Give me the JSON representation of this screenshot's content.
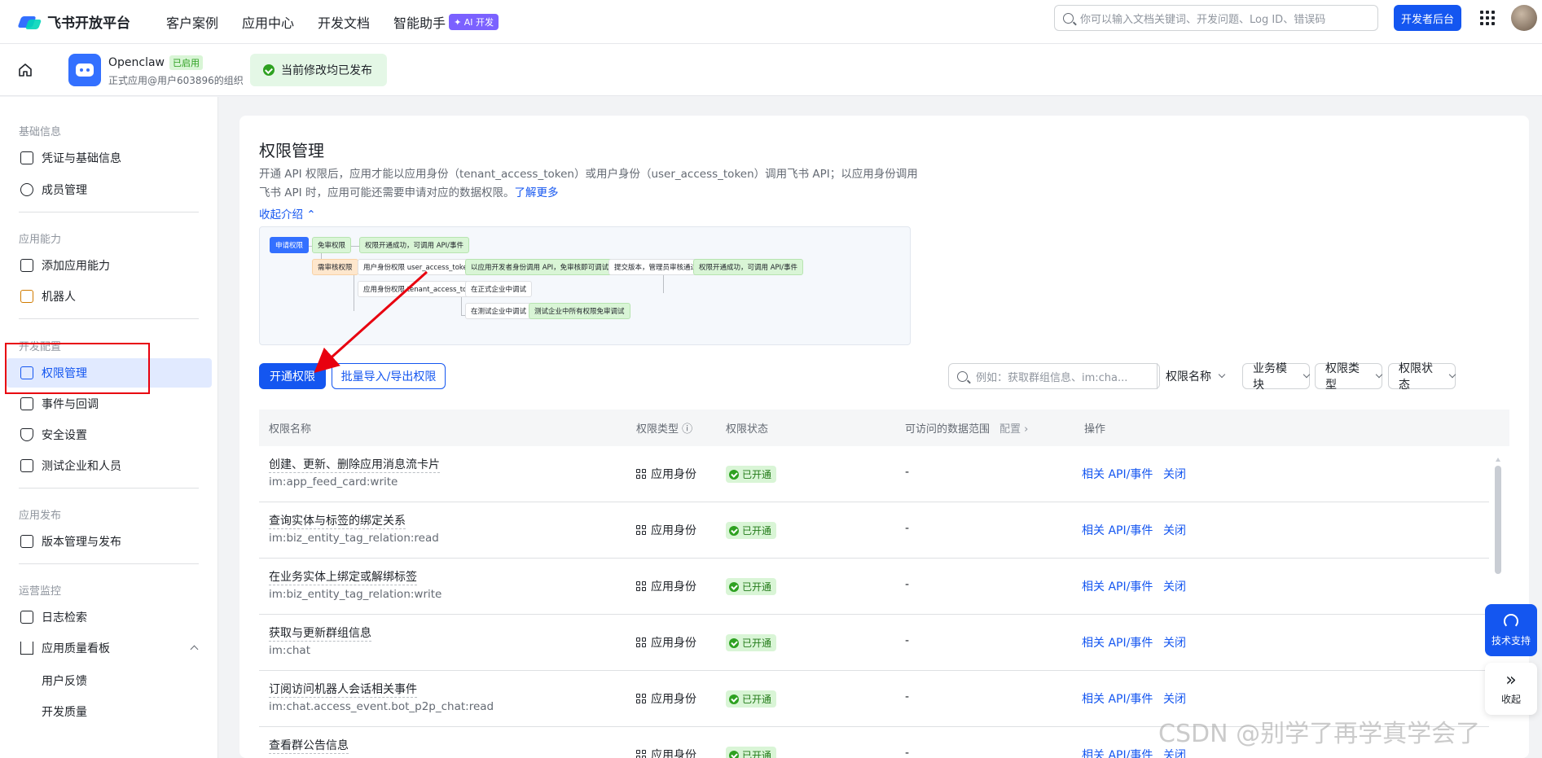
{
  "topbar": {
    "logo_text": "飞书开放平台",
    "nav": [
      "客户案例",
      "应用中心",
      "开发文档",
      "智能助手"
    ],
    "ai_badge": "✦ AI 开发",
    "search_placeholder": "你可以输入文档关键词、开发问题、Log ID、错误码",
    "dev_console": "开发者后台"
  },
  "app": {
    "name": "Openclaw",
    "status_tag": "已启用",
    "org": "正式应用@用户603896的组织",
    "publish_status": "当前修改均已发布"
  },
  "sidebar": {
    "sections": [
      {
        "title": "基础信息",
        "items": [
          {
            "label": "凭证与基础信息",
            "icon": "credential-icon"
          },
          {
            "label": "成员管理",
            "icon": "member-icon"
          }
        ]
      },
      {
        "title": "应用能力",
        "items": [
          {
            "label": "添加应用能力",
            "icon": "apps-grid-icon"
          },
          {
            "label": "机器人",
            "icon": "robot-icon"
          }
        ]
      },
      {
        "title": "开发配置",
        "items": [
          {
            "label": "权限管理",
            "icon": "lock-icon",
            "active": true
          },
          {
            "label": "事件与回调",
            "icon": "event-icon"
          },
          {
            "label": "安全设置",
            "icon": "shield-icon"
          },
          {
            "label": "测试企业和人员",
            "icon": "code-icon"
          }
        ]
      },
      {
        "title": "应用发布",
        "items": [
          {
            "label": "版本管理与发布",
            "icon": "upload-icon"
          }
        ]
      },
      {
        "title": "运营监控",
        "items": [
          {
            "label": "日志检索",
            "icon": "log-search-icon"
          },
          {
            "label": "应用质量看板",
            "icon": "chart-icon"
          }
        ],
        "subitems": [
          "用户反馈",
          "开发质量"
        ]
      }
    ]
  },
  "main": {
    "title": "权限管理",
    "desc": "开通 API 权限后，应用才能以应用身份（tenant_access_token）或用户身份（user_access_token）调用飞书 API；以应用身份调用飞书 API 时，应用可能还需要申请对应的数据权限。",
    "learn_more": "了解更多",
    "collapse": "收起介绍 ⌃",
    "flow": {
      "apply": "申请权限",
      "no_review": "免审权限",
      "opened_1": "权限开通成功，可调用 API/事件",
      "need_review": "需审核权限",
      "user_identity": "用户身份权限 user_access_token 调用",
      "dev_identity": "以应用开发者身份调用 API，免审核即可调试",
      "submit": "提交版本，管理员审核通过",
      "opened_2": "权限开通成功，可调用 API/事件",
      "app_identity": "应用身份权限 tenant_access_token 调用",
      "prod_debug": "在正式企业中调试",
      "test_debug": "在测试企业中调试",
      "test_free": "测试企业中所有权限免审调试"
    },
    "buttons": {
      "open": "开通权限",
      "batch": "批量导入/导出权限"
    },
    "filter": {
      "search_placeholder": "例如：获取群组信息、im:cha...",
      "search_by": "权限名称",
      "module": "业务模块",
      "type": "权限类型",
      "status": "权限状态"
    },
    "table": {
      "headers": {
        "name": "权限名称",
        "type": "权限类型 ⓘ",
        "status": "权限状态",
        "scope": "可访问的数据范围",
        "scope_config": "配置 ›",
        "ops": "操作"
      },
      "rows": [
        {
          "name": "创建、更新、删除应用消息流卡片",
          "code": "im:app_feed_card:write",
          "type": "应用身份",
          "status": "已开通",
          "scope": "-",
          "api": "相关 API/事件",
          "close": "关闭"
        },
        {
          "name": "查询实体与标签的绑定关系",
          "code": "im:biz_entity_tag_relation:read",
          "type": "应用身份",
          "status": "已开通",
          "scope": "-",
          "api": "相关 API/事件",
          "close": "关闭"
        },
        {
          "name": "在业务实体上绑定或解绑标签",
          "code": "im:biz_entity_tag_relation:write",
          "type": "应用身份",
          "status": "已开通",
          "scope": "-",
          "api": "相关 API/事件",
          "close": "关闭"
        },
        {
          "name": "获取与更新群组信息",
          "code": "im:chat",
          "type": "应用身份",
          "status": "已开通",
          "scope": "-",
          "api": "相关 API/事件",
          "close": "关闭"
        },
        {
          "name": "订阅访问机器人会话相关事件",
          "code": "im:chat.access_event.bot_p2p_chat:read",
          "type": "应用身份",
          "status": "已开通",
          "scope": "-",
          "api": "相关 API/事件",
          "close": "关闭"
        },
        {
          "name": "查看群公告信息",
          "code": "",
          "type": "应用身份",
          "status": "已开通",
          "scope": "-",
          "api": "相关 API/事件",
          "close": "关闭"
        }
      ]
    }
  },
  "floating": {
    "support": "技术支持",
    "collapse": "收起"
  },
  "watermark": "CSDN @别学了再学真学会了",
  "colors": {
    "primary": "#1456f0",
    "success": "#2ea121",
    "annotation": "#e8000f"
  }
}
